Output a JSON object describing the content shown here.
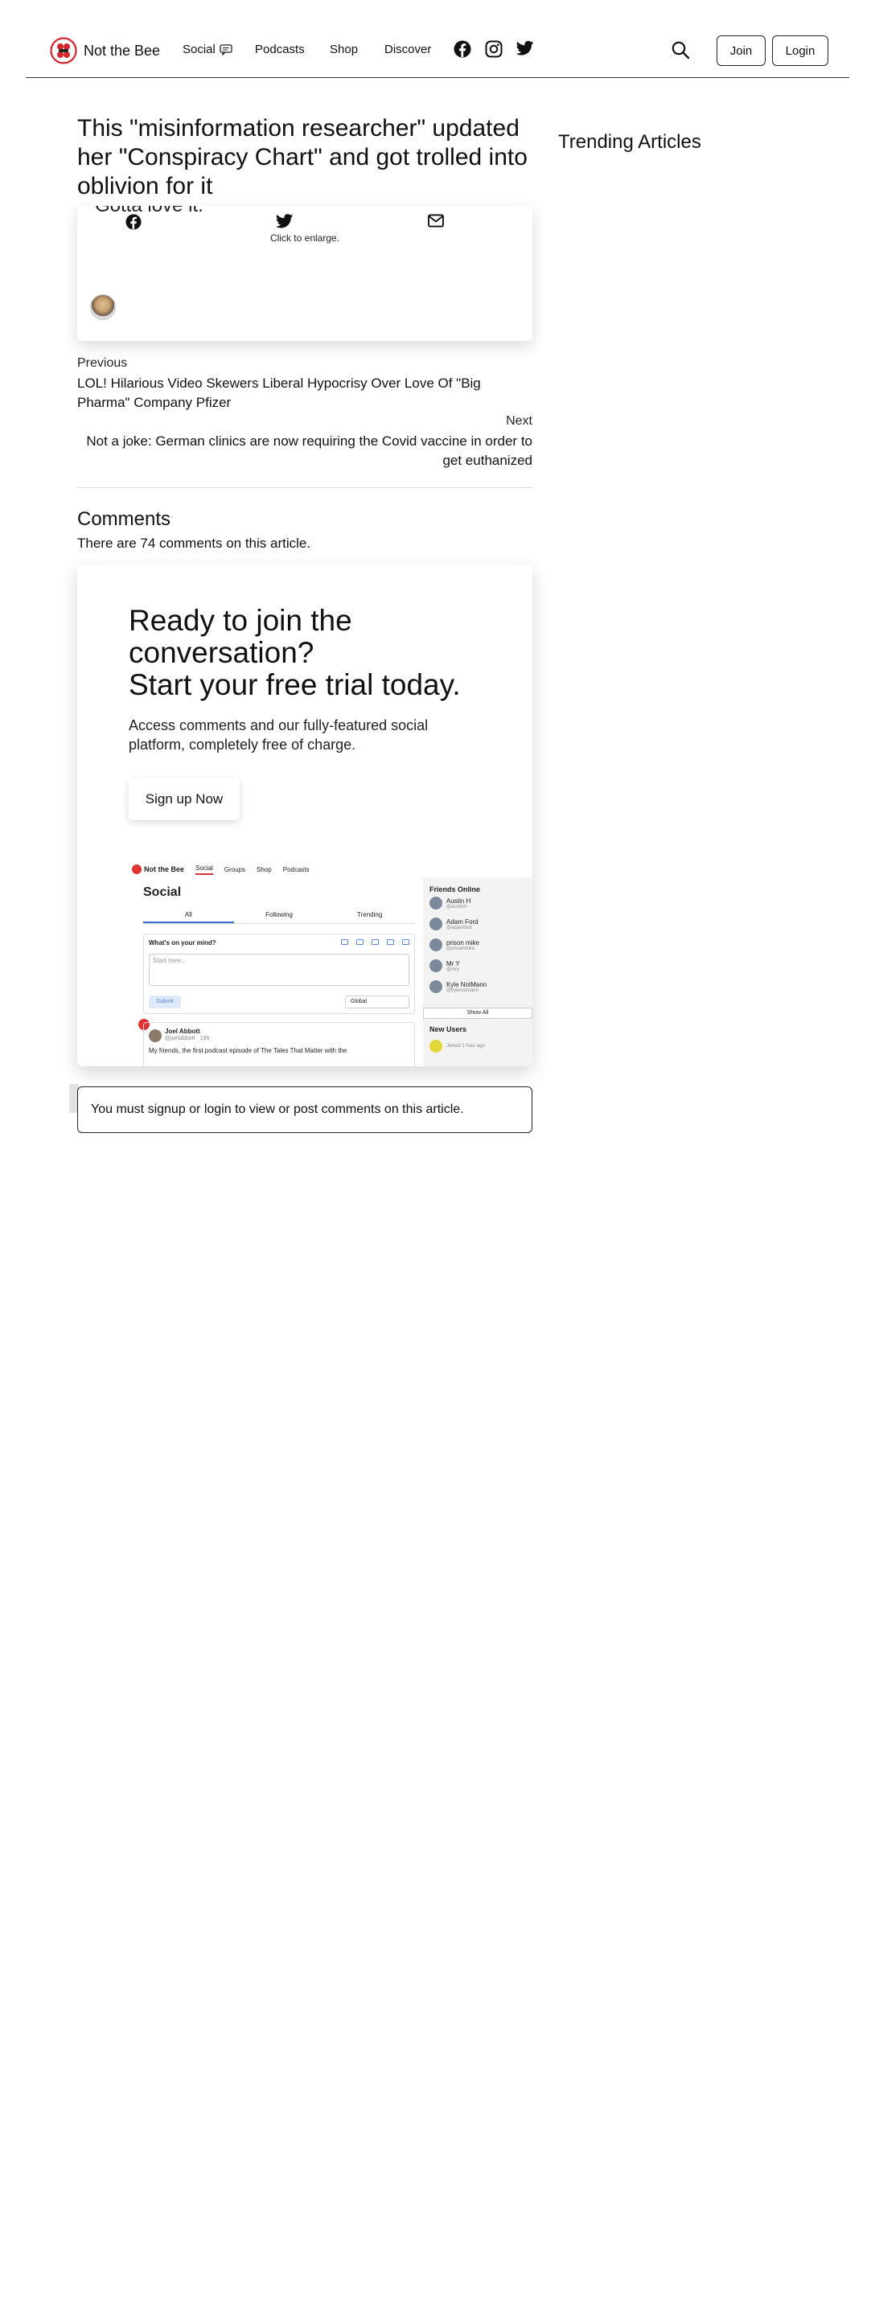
{
  "header": {
    "brand": "Not the Bee",
    "nav": [
      {
        "label": "Social"
      },
      {
        "label": "Podcasts"
      },
      {
        "label": "Shop"
      },
      {
        "label": "Discover"
      }
    ],
    "social_icons": [
      "facebook-icon",
      "instagram-icon",
      "twitter-icon"
    ],
    "join_label": "Join",
    "login_label": "Login"
  },
  "article": {
    "title": "This \"misinformation researcher\" updated her \"Conspiracy Chart\" and got trolled into oblivion for it",
    "caption": "Gotta love it.",
    "enlarge_text": "Click to enlarge."
  },
  "pagination": {
    "prev_label": "Previous",
    "prev_title": "LOL! Hilarious Video Skewers Liberal Hypocrisy Over Love Of \"Big Pharma\" Company Pfizer",
    "next_label": "Next",
    "next_title": "Not a joke: German clinics are now requiring the Covid vaccine in order to get euthanized"
  },
  "comments": {
    "heading": "Comments",
    "count_text": "There are 74 comments on this article."
  },
  "promo": {
    "heading_line1": "Ready to join the conversation?",
    "heading_line2": "Start your free trial today.",
    "body": "Access comments and our fully-featured social platform, completely free of charge.",
    "cta": "Sign up Now",
    "mock": {
      "brand": "Not the Bee",
      "nav": [
        "Social",
        "Groups",
        "Shop",
        "Podcasts"
      ],
      "title": "Social",
      "tabs": [
        "All",
        "Following",
        "Trending"
      ],
      "prompt": "What's on your mind?",
      "placeholder": "Start here...",
      "submit": "Submit",
      "scope": "Global",
      "feed_name": "Joel Abbott",
      "feed_handle": "@joelabbott · 19h",
      "feed_body": "My friends, the first podcast episode of The Tales That Matter with the",
      "friends_title": "Friends Online",
      "friends": [
        {
          "name": "Austin H",
          "handle": "@austinh"
        },
        {
          "name": "Adam Ford",
          "handle": "@adamford"
        },
        {
          "name": "prison mike",
          "handle": "@prisonmike"
        },
        {
          "name": "Mr Y",
          "handle": "@mry"
        },
        {
          "name": "Kyle NotMann",
          "handle": "@kylenotmann"
        }
      ],
      "show_all": "Show All",
      "new_users_title": "New Users",
      "new_user_text": "Joined 1 hour ago"
    }
  },
  "login_notice": "You must signup or login to view or post comments on this article.",
  "sidebar": {
    "trending_title": "Trending Articles"
  }
}
